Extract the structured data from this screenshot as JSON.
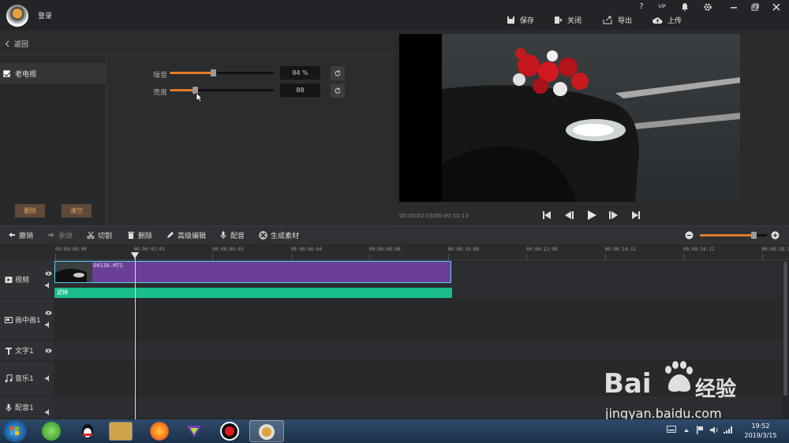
{
  "app": {
    "login_label": "登录"
  },
  "window_controls": {
    "help": "?",
    "vip": "VIP"
  },
  "top_toolbar": {
    "save": "保存",
    "close": "关闭",
    "export": "导出",
    "upload": "上传"
  },
  "back": {
    "label": "返回"
  },
  "filters": {
    "items": [
      {
        "label": "老电视",
        "checked": true
      }
    ],
    "delete_button": "删除",
    "clear_button": "清空"
  },
  "params": {
    "noise": {
      "label": "噪音",
      "value_text": "84 %",
      "level": 0.42
    },
    "brightness": {
      "label": "亮度",
      "value_text": "88",
      "level": 0.24
    }
  },
  "preview": {
    "timecode": "00:00:02:03/00:00:10:13"
  },
  "edit_toolbar": {
    "undo": "撤销",
    "redo": "重做",
    "cut": "切割",
    "delete": "删除",
    "advanced": "高级编辑",
    "dub": "配音",
    "generate": "生成素材",
    "zoom_level": 0.8
  },
  "ruler": {
    "labels": [
      "00:00:00:00",
      "00:00:02:01",
      "00:00:04:03",
      "00:00:06:04",
      "00:00:08:06",
      "00:00:10:08",
      "00:00:12:09",
      "00:00:14:11",
      "00:00:16:12",
      "00:00:18:1"
    ]
  },
  "tracks": [
    {
      "label": "视频"
    },
    {
      "label": "画中画1"
    },
    {
      "label": "文字1"
    },
    {
      "label": "音乐1"
    },
    {
      "label": "配音1"
    }
  ],
  "timeline": {
    "clip_name": "00138.MTS",
    "effect_label": "滤镜"
  },
  "taskbar": {
    "time": "19:52",
    "date": "2019/3/15"
  },
  "watermark": {
    "brand": "Bai",
    "brand2": "经验",
    "url": "jingyan.baidu.com"
  },
  "colors": {
    "accent": "#e37b2a",
    "clip": "#6b3f96",
    "effect": "#1abc8c",
    "clip_border": "#5ad0f0"
  }
}
